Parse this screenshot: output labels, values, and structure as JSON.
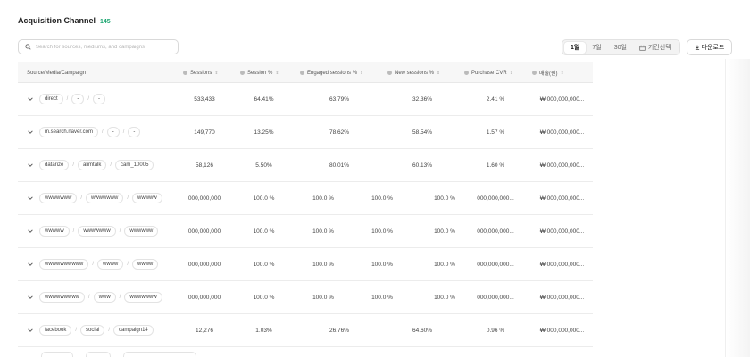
{
  "header": {
    "title": "Acquisition Channel",
    "count": "145"
  },
  "search": {
    "placeholder": "Search for sources, mediums, and campaigns"
  },
  "period": {
    "options": [
      "1일",
      "7일",
      "30일"
    ],
    "active": "1일",
    "custom_label": "기간선택"
  },
  "download": {
    "label": "다운로드"
  },
  "columns": {
    "source": "Source/Media/Campaign",
    "sessions": "Sessions",
    "session_pct": "Session %",
    "engaged_pct": "Engaged sessions %",
    "new_pct": "New sessions %",
    "purchase_cvr": "Purchase CVR",
    "last": "매출(원)"
  },
  "rows": [
    {
      "chips": [
        "direct",
        "-",
        "-"
      ],
      "sessions": "533,433",
      "session_pct": "64.41%",
      "engaged_pct": "63.79%",
      "new_pct": "32.36%",
      "purchase_cvr": "2.41 %",
      "last": "₩ 000,000,000..."
    },
    {
      "chips": [
        "m.search.naver.com",
        "-",
        "-"
      ],
      "sessions": "149,770",
      "session_pct": "13.25%",
      "engaged_pct": "78.62%",
      "new_pct": "58.54%",
      "purchase_cvr": "1.57 %",
      "last": "₩ 000,000,000..."
    },
    {
      "chips": [
        "datarize",
        "alimtalk",
        "cam_10005"
      ],
      "sessions": "58,126",
      "session_pct": "5.50%",
      "engaged_pct": "80.01%",
      "new_pct": "60.13%",
      "purchase_cvr": "1.60 %",
      "last": "₩ 000,000,000..."
    },
    {
      "chips": [
        "wwwwwww",
        "wwwwwww",
        "wwwww"
      ],
      "sessions": "000,000,000",
      "session_pct": "100.0 %",
      "engaged_pct": "100.0 %",
      "extra": "100.0 %",
      "new_pct": "100.0 %",
      "purchase_cvr": "000,000,000...",
      "last": "₩ 000,000,000..."
    },
    {
      "chips": [
        "wwwww",
        "wwwwwww",
        "wwwwww"
      ],
      "sessions": "000,000,000",
      "session_pct": "100.0 %",
      "engaged_pct": "100.0 %",
      "extra": "100.0 %",
      "new_pct": "100.0 %",
      "purchase_cvr": "000,000,000...",
      "last": "₩ 000,000,000..."
    },
    {
      "chips": [
        "wwwwwwwwww",
        "wwww",
        "wwww"
      ],
      "sessions": "000,000,000",
      "session_pct": "100.0 %",
      "engaged_pct": "100.0 %",
      "extra": "100.0 %",
      "new_pct": "100.0 %",
      "purchase_cvr": "000,000,000...",
      "last": "₩ 000,000,000..."
    },
    {
      "chips": [
        "wwwwwwwww",
        "www",
        "wwwwwww"
      ],
      "sessions": "000,000,000",
      "session_pct": "100.0 %",
      "engaged_pct": "100.0 %",
      "extra": "100.0 %",
      "new_pct": "100.0 %",
      "purchase_cvr": "000,000,000...",
      "last": "₩ 000,000,000..."
    },
    {
      "chips": [
        "facebook",
        "social",
        "campaign14"
      ],
      "sessions": "12,276",
      "session_pct": "1.03%",
      "engaged_pct": "26.76%",
      "new_pct": "64.60%",
      "purchase_cvr": "0.96 %",
      "last": "₩ 000,000,000..."
    }
  ],
  "colors": {
    "accent": "#19a56f",
    "border": "#e3e3e3",
    "header_bg": "#f7f7f7"
  },
  "icons": {
    "search": "search-icon",
    "calendar": "calendar-icon",
    "download": "download-icon",
    "expand": "chevron-down-icon",
    "sort": "sort-icon"
  }
}
